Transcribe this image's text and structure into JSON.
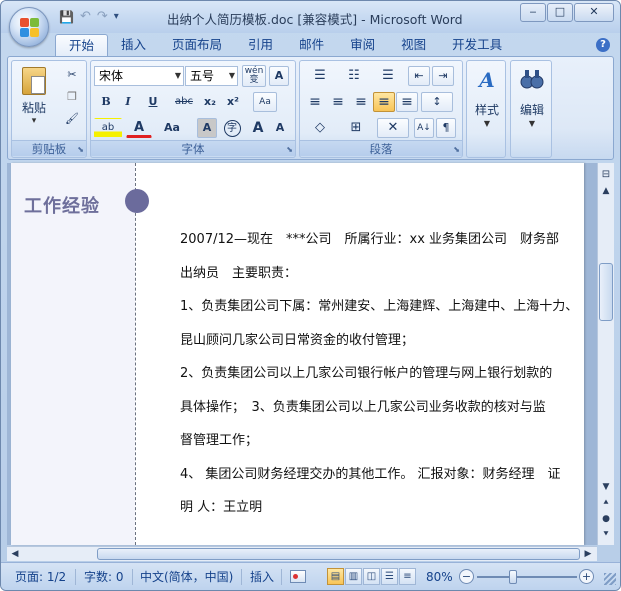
{
  "window": {
    "title": "出纳个人简历模板.doc [兼容模式] - Microsoft Word",
    "minimize": "‒",
    "maximize": "□",
    "close": "✕"
  },
  "qat": {
    "save_icon": "💾",
    "undo_icon": "↶",
    "redo_icon": "↷",
    "customize_icon": "▾"
  },
  "tabs": [
    "开始",
    "插入",
    "页面布局",
    "引用",
    "邮件",
    "审阅",
    "视图",
    "开发工具"
  ],
  "help_icon": "?",
  "ribbon": {
    "clipboard": {
      "label": "剪贴板",
      "paste_label": "粘贴",
      "paste_arrow": "▾",
      "cut_icon": "✂",
      "copy_icon": "❐",
      "format_painter_icon": "🖌",
      "launcher": "⬊"
    },
    "font": {
      "label": "字体",
      "font_name": "宋体",
      "font_size": "五号",
      "wen_label": "wén\n变",
      "char_border": "A",
      "bold": "B",
      "italic": "I",
      "underline": "U",
      "strike": "abc",
      "subscript": "x₂",
      "superscript": "x²",
      "clear_format": "Aa",
      "highlight": "ab",
      "font_color": "A",
      "change_case": "Aa",
      "char_shading": "A",
      "enclose": "字",
      "grow": "A",
      "shrink": "A",
      "launcher": "⬊"
    },
    "paragraph": {
      "label": "段落",
      "bullets": "☰",
      "numbering": "☷",
      "multilevel": "☰",
      "dec_indent": "⇤",
      "inc_indent": "⇥",
      "align_left": "≡",
      "center": "≡",
      "align_right": "≡",
      "justify": "≡",
      "distribute": "≡",
      "line_spacing": "↕",
      "shading": "◇",
      "borders": "⊞",
      "asian_layout": "✕",
      "sort": "A↓",
      "show_marks": "¶",
      "launcher": "⬊"
    },
    "styles": {
      "label": "样式",
      "icon": "A"
    },
    "editing": {
      "label": "编辑",
      "icon": "🔍"
    }
  },
  "document": {
    "section_title": "工作经验",
    "lines": [
      "2007/12—现在　***公司　所属行业：xx 业务集团公司　财务部",
      "出纳员　主要职责：",
      "1、负责集团公司下属：常州建安、上海建辉、上海建中、上海十力、",
      "昆山顾问几家公司日常资金的收付管理；",
      "2、负责集团公司以上几家公司银行帐户的管理与网上银行划款的",
      "具体操作；　3、负责集团公司以上几家公司业务收款的核对与监",
      "督管理工作；",
      "4、 集团公司财务经理交办的其他工作。 汇报对象：财务经理　证",
      "明 人：王立明"
    ]
  },
  "scrollbar": {
    "up": "▲",
    "down": "▼",
    "prev_page": "⯅",
    "browse_object": "●",
    "next_page": "⯆",
    "left": "◀",
    "right": "▶",
    "ruler_icon": "⊟"
  },
  "statusbar": {
    "page": "页面: 1/2",
    "words": "字数: 0",
    "language": "中文(简体，中国)",
    "mode": "插入",
    "zoom": "80%",
    "zoom_out": "−",
    "zoom_in": "+"
  },
  "colors": {
    "accent": "#15428b",
    "section_title": "#6e6f9b",
    "dot": "#6b6b9c",
    "sidebar_bg": "#f3f4fb"
  }
}
